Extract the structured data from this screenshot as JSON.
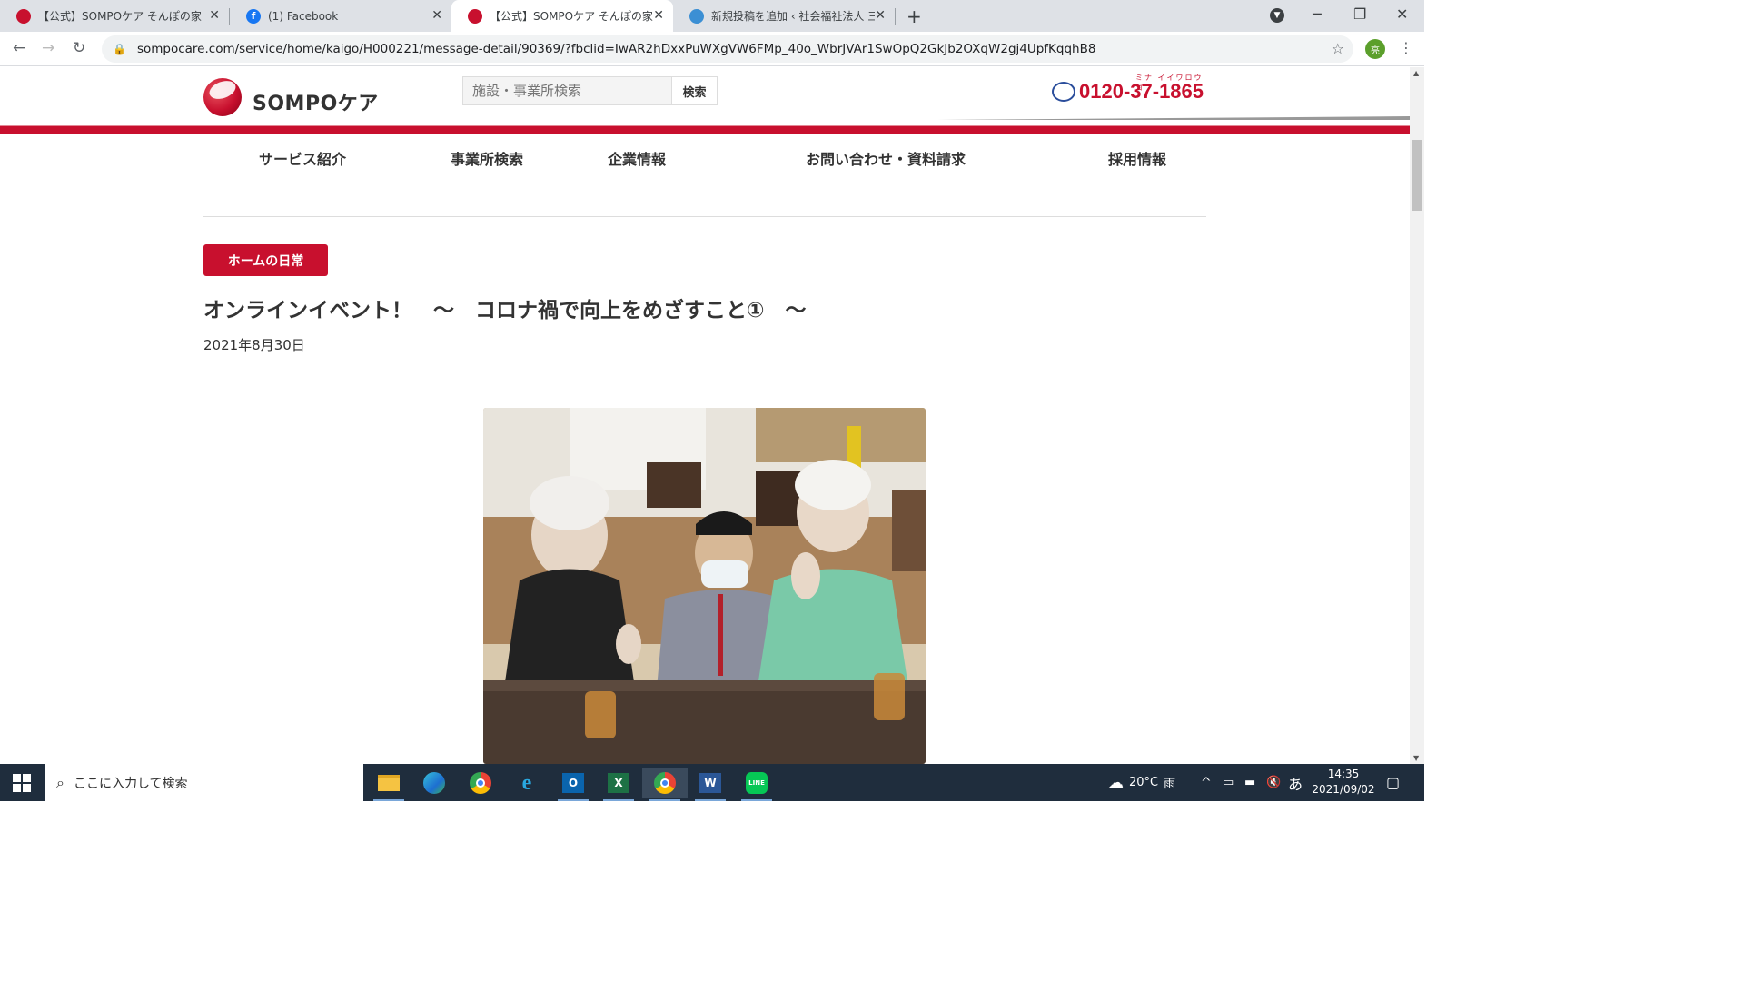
{
  "browser": {
    "tabs": [
      {
        "title": "【公式】SOMPOケア そんぽの家　大",
        "close": "✕"
      },
      {
        "title": "(1) Facebook",
        "close": "✕"
      },
      {
        "title": "【公式】SOMPOケア そんぽの家　東",
        "close": "✕"
      },
      {
        "title": "新規投稿を追加 ‹ 社会福祉法人 三",
        "close": "✕"
      }
    ],
    "new_tab": "+",
    "url": "sompocare.com/service/home/kaigo/H000221/message-detail/90369/?fbclid=IwAR2hDxxPuWXgVW6FMp_40o_WbrJVAr1SwOpQ2GkJb2OXqW2gj4UpfKqqhB8",
    "profile_initial": "亮",
    "window_controls": {
      "minimize": "─",
      "maximize": "❐",
      "close": "✕"
    }
  },
  "site": {
    "logo_text": "SOMPOケア",
    "search": {
      "placeholder": "施設・事業所検索",
      "button": "検索"
    },
    "phone": {
      "number": "0120-37-1865",
      "ruby": "ミナ イイワロウゴ"
    },
    "nav": [
      "サービス紹介",
      "事業所検索",
      "企業情報",
      "お問い合わせ・資料請求",
      "採用情報"
    ]
  },
  "article": {
    "category": "ホームの日常",
    "title": "オンラインイベント！　～　コロナ禍で向上をめざすこと①　～",
    "date": "2021年8月30日"
  },
  "taskbar": {
    "search_placeholder": "ここに入力して検索",
    "weather": {
      "temp": "20°C",
      "condition": "雨"
    },
    "ime": "あ",
    "time": "14:35",
    "date": "2021/09/02"
  },
  "colors": {
    "brand_red": "#c8102e",
    "taskbar": "#1f2d3d"
  }
}
